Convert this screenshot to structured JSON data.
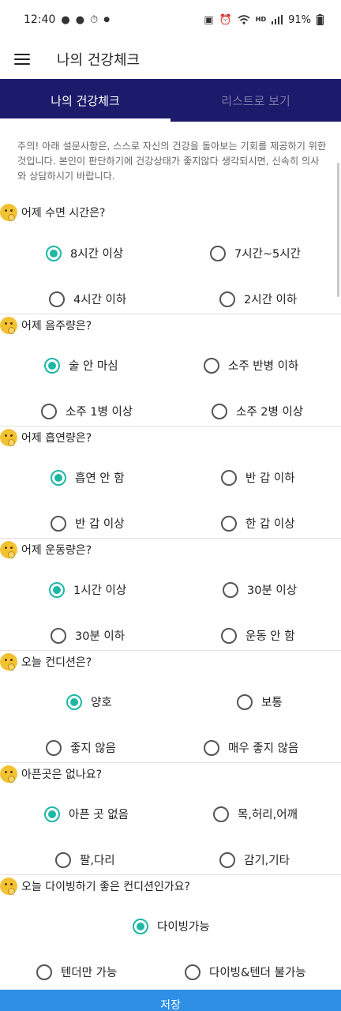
{
  "status_bar": {
    "time": "12:40",
    "battery": "91%",
    "icons": [
      "chat-bubble-icon",
      "kakao-talk-icon",
      "timer-icon",
      "dot-icon",
      "lock-icon",
      "alarm-icon",
      "wifi-icon",
      "hd-voice-icon",
      "signal-icon",
      "battery-icon"
    ],
    "hd_label": "HD"
  },
  "app_bar": {
    "title": "나의 건강체크"
  },
  "tabs": [
    {
      "label": "나의 건강체크",
      "active": true
    },
    {
      "label": "리스트로 보기",
      "active": false
    }
  ],
  "notice": "주의! 아래 설문사항은, 스스로 자신의 건강을 돌아보는 기회를 제공하기 위한 것입니다. 본인이 판단하기에 건강상태가 좋지않다 생각되시면, 신속히 의사와 상담하시기 바랍니다.",
  "questions": [
    {
      "text": "어제 수면 시간은?",
      "options": [
        {
          "label": "8시간 이상",
          "checked": true
        },
        {
          "label": "7시간~5시간",
          "checked": false
        },
        {
          "label": "4시간 이하",
          "checked": false
        },
        {
          "label": "2시간 이하",
          "checked": false
        }
      ]
    },
    {
      "text": "어제 음주량은?",
      "options": [
        {
          "label": "술 안 마심",
          "checked": true
        },
        {
          "label": "소주 반병 이하",
          "checked": false
        },
        {
          "label": "소주 1병 이상",
          "checked": false
        },
        {
          "label": "소주 2병 이상",
          "checked": false
        }
      ]
    },
    {
      "text": "어제 흡연량은?",
      "options": [
        {
          "label": "흡연 안 함",
          "checked": true
        },
        {
          "label": "반 갑 이하",
          "checked": false
        },
        {
          "label": "반 갑 이상",
          "checked": false
        },
        {
          "label": "한 갑 이상",
          "checked": false
        }
      ]
    },
    {
      "text": "어제 운동량은?",
      "options": [
        {
          "label": "1시간 이상",
          "checked": true
        },
        {
          "label": "30분 이상",
          "checked": false
        },
        {
          "label": "30분 이하",
          "checked": false
        },
        {
          "label": "운동 안 함",
          "checked": false
        }
      ]
    },
    {
      "text": "오늘 컨디션은?",
      "options": [
        {
          "label": "양호",
          "checked": true
        },
        {
          "label": "보통",
          "checked": false
        },
        {
          "label": "좋지 않음",
          "checked": false
        },
        {
          "label": "매우 좋지 않음",
          "checked": false
        }
      ]
    },
    {
      "text": "아픈곳은 없나요?",
      "options": [
        {
          "label": "아픈 곳 없음",
          "checked": true
        },
        {
          "label": "목,허리,어깨",
          "checked": false
        },
        {
          "label": "팔,다리",
          "checked": false
        },
        {
          "label": "감기,기타",
          "checked": false
        }
      ]
    },
    {
      "text": "오늘 다이빙하기 좋은 컨디션인가요?",
      "options": [
        {
          "label": "다이빙가능",
          "checked": true
        },
        {
          "label": "텐더만 가능",
          "checked": false
        },
        {
          "label": "다이빙&텐더 불가능",
          "checked": false
        }
      ]
    }
  ],
  "save_button": "저장"
}
